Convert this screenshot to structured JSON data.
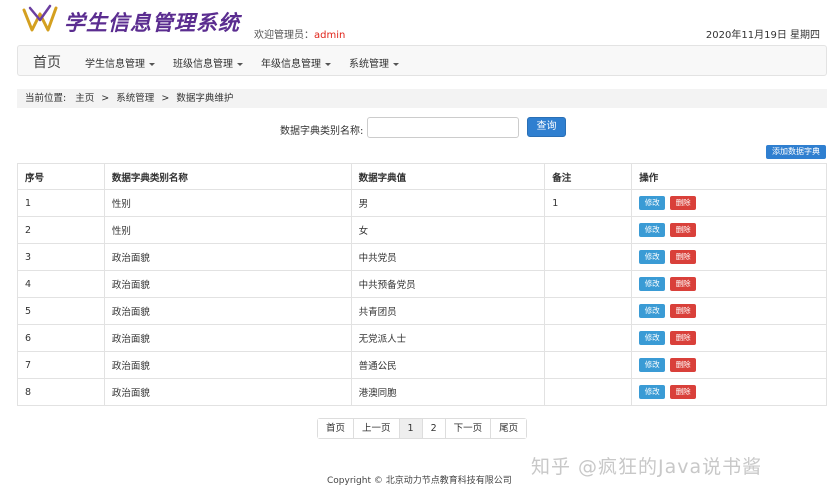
{
  "header": {
    "app_title": "学生信息管理系统",
    "welcome_label": "欢迎管理员：",
    "user_name": "admin",
    "date": "2020年11月19日 星期四"
  },
  "nav": {
    "home": "首页",
    "items": [
      "学生信息管理",
      "班级信息管理",
      "年级信息管理",
      "系统管理"
    ]
  },
  "breadcrumb": {
    "prefix": "当前位置:",
    "items": [
      "主页",
      "系统管理",
      "数据字典维护"
    ],
    "separator": ">"
  },
  "search": {
    "label": "数据字典类别名称:",
    "value": "",
    "button": "查询"
  },
  "add_button": "添加数据字典",
  "table": {
    "columns": [
      "序号",
      "数据字典类别名称",
      "数据字典值",
      "备注",
      "操作"
    ],
    "rows": [
      {
        "id": "1",
        "category": "性别",
        "value": "男",
        "note": "1"
      },
      {
        "id": "2",
        "category": "性别",
        "value": "女",
        "note": ""
      },
      {
        "id": "3",
        "category": "政治面貌",
        "value": "中共党员",
        "note": ""
      },
      {
        "id": "4",
        "category": "政治面貌",
        "value": "中共预备党员",
        "note": ""
      },
      {
        "id": "5",
        "category": "政治面貌",
        "value": "共青团员",
        "note": ""
      },
      {
        "id": "6",
        "category": "政治面貌",
        "value": "无党派人士",
        "note": ""
      },
      {
        "id": "7",
        "category": "政治面貌",
        "value": "普通公民",
        "note": ""
      },
      {
        "id": "8",
        "category": "政治面貌",
        "value": "港澳同胞",
        "note": ""
      }
    ],
    "edit_label": "修改",
    "delete_label": "删除"
  },
  "pagination": {
    "first": "首页",
    "prev": "上一页",
    "pages": [
      "1",
      "2"
    ],
    "current": "1",
    "next": "下一页",
    "last": "尾页"
  },
  "footer": "Copyright © 北京动力节点教育科技有限公司",
  "watermark": "知乎 @疯狂的Java说书酱",
  "colors": {
    "title": "#5b2d90",
    "user": "#e0241a",
    "primary_button": "#2f7fd0",
    "edit_button": "#3a9bd5",
    "delete_button": "#d9403a"
  }
}
